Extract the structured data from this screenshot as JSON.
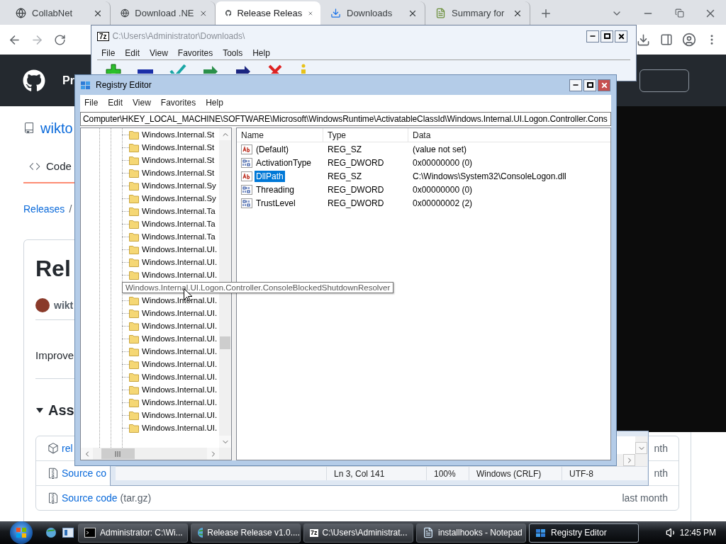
{
  "browser": {
    "tabs": [
      {
        "title": "CollabNet",
        "kind": "globe",
        "selected": false
      },
      {
        "title": "Download .NE",
        "kind": "globe",
        "selected": false
      },
      {
        "title": "Release Releas",
        "kind": "github",
        "selected": true
      },
      {
        "title": "Downloads",
        "kind": "download",
        "selected": false
      },
      {
        "title": "Summary for",
        "kind": "document",
        "selected": false
      }
    ]
  },
  "github": {
    "header_text": "Pr",
    "repo": "wikto",
    "nav_tabs": [
      {
        "label": "Code",
        "selected": true
      }
    ],
    "breadcrumb_link": "Releases",
    "breadcrumb_rest": "/",
    "release_title": "Rel",
    "author": "wikt",
    "body": "Improve",
    "assets_heading": "Ass",
    "assets": [
      {
        "name": "rel",
        "kind": "package",
        "date": "nth"
      },
      {
        "name": "Source co",
        "kind": "zip",
        "date": "nth"
      },
      {
        "name": "Source code",
        "suffix": "(tar.gz)",
        "kind": "zip",
        "date": "last month"
      }
    ]
  },
  "sevenzip": {
    "logo": "7z",
    "title": "C:\\Users\\Administrator\\Downloads\\",
    "menu": [
      "File",
      "Edit",
      "View",
      "Favorites",
      "Tools",
      "Help"
    ]
  },
  "notepad": {
    "status": [
      "Ln 3, Col 141",
      "100%",
      "Windows (CRLF)",
      "UTF-8"
    ]
  },
  "regedit": {
    "title": "Registry Editor",
    "menu": [
      "File",
      "Edit",
      "View",
      "Favorites",
      "Help"
    ],
    "address": "Computer\\HKEY_LOCAL_MACHINE\\SOFTWARE\\Microsoft\\WindowsRuntime\\ActivatableClassId\\Windows.Internal.UI.Logon.Controller.Cons",
    "tree": [
      {
        "label": "Windows.Internal.St",
        "hovered": false
      },
      {
        "label": "Windows.Internal.St",
        "hovered": false
      },
      {
        "label": "Windows.Internal.St",
        "hovered": false
      },
      {
        "label": "Windows.Internal.St",
        "hovered": false
      },
      {
        "label": "Windows.Internal.Sy",
        "hovered": false
      },
      {
        "label": "Windows.Internal.Sy",
        "hovered": false
      },
      {
        "label": "Windows.Internal.Ta",
        "hovered": false
      },
      {
        "label": "Windows.Internal.Ta",
        "hovered": false
      },
      {
        "label": "Windows.Internal.Ta",
        "hovered": false
      },
      {
        "label": "Windows.Internal.UI.",
        "hovered": false
      },
      {
        "label": "Windows.Internal.UI.",
        "hovered": false
      },
      {
        "label": "Windows.Internal.UI.",
        "hovered": false
      },
      {
        "label": "Windows.Internal.UI.Logon.Controller.ConsoleBlockedShutdownResolver",
        "hovered": true
      },
      {
        "label": "Windows.Internal.UI.",
        "hovered": false
      },
      {
        "label": "Windows.Internal.UI.",
        "hovered": false
      },
      {
        "label": "Windows.Internal.UI.",
        "hovered": false
      },
      {
        "label": "Windows.Internal.UI.",
        "hovered": false
      },
      {
        "label": "Windows.Internal.UI.",
        "hovered": false
      },
      {
        "label": "Windows.Internal.UI.",
        "hovered": false
      },
      {
        "label": "Windows.Internal.UI.",
        "hovered": false
      },
      {
        "label": "Windows.Internal.UI.",
        "hovered": false
      },
      {
        "label": "Windows.Internal.UI.",
        "hovered": false
      },
      {
        "label": "Windows.Internal.UI.",
        "hovered": false
      },
      {
        "label": "Windows.Internal.UI.",
        "hovered": false
      }
    ],
    "columns": [
      "Name",
      "Type",
      "Data"
    ],
    "values": [
      {
        "name": "(Default)",
        "type": "REG_SZ",
        "data": "(value not set)",
        "kind": "string",
        "selected": false
      },
      {
        "name": "ActivationType",
        "type": "REG_DWORD",
        "data": "0x00000000 (0)",
        "kind": "dword",
        "selected": false
      },
      {
        "name": "DllPath",
        "type": "REG_SZ",
        "data": "C:\\Windows\\System32\\ConsoleLogon.dll",
        "kind": "string",
        "selected": true
      },
      {
        "name": "Threading",
        "type": "REG_DWORD",
        "data": "0x00000000 (0)",
        "kind": "dword",
        "selected": false
      },
      {
        "name": "TrustLevel",
        "type": "REG_DWORD",
        "data": "0x00000002 (2)",
        "kind": "dword",
        "selected": false
      }
    ]
  },
  "taskbar": {
    "buttons": [
      {
        "label": "Administrator: C:\\Wi...",
        "kind": "console",
        "selected": false
      },
      {
        "label": "Release Release v1.0....",
        "kind": "browser",
        "selected": false
      },
      {
        "label": "C:\\Users\\Administrat...",
        "kind": "archive",
        "badge": "7z",
        "selected": false
      },
      {
        "label": "installhooks - Notepad",
        "kind": "notepad",
        "selected": false
      },
      {
        "label": "Registry Editor",
        "kind": "regedit",
        "selected": true
      }
    ],
    "clock": "12:45 PM"
  }
}
